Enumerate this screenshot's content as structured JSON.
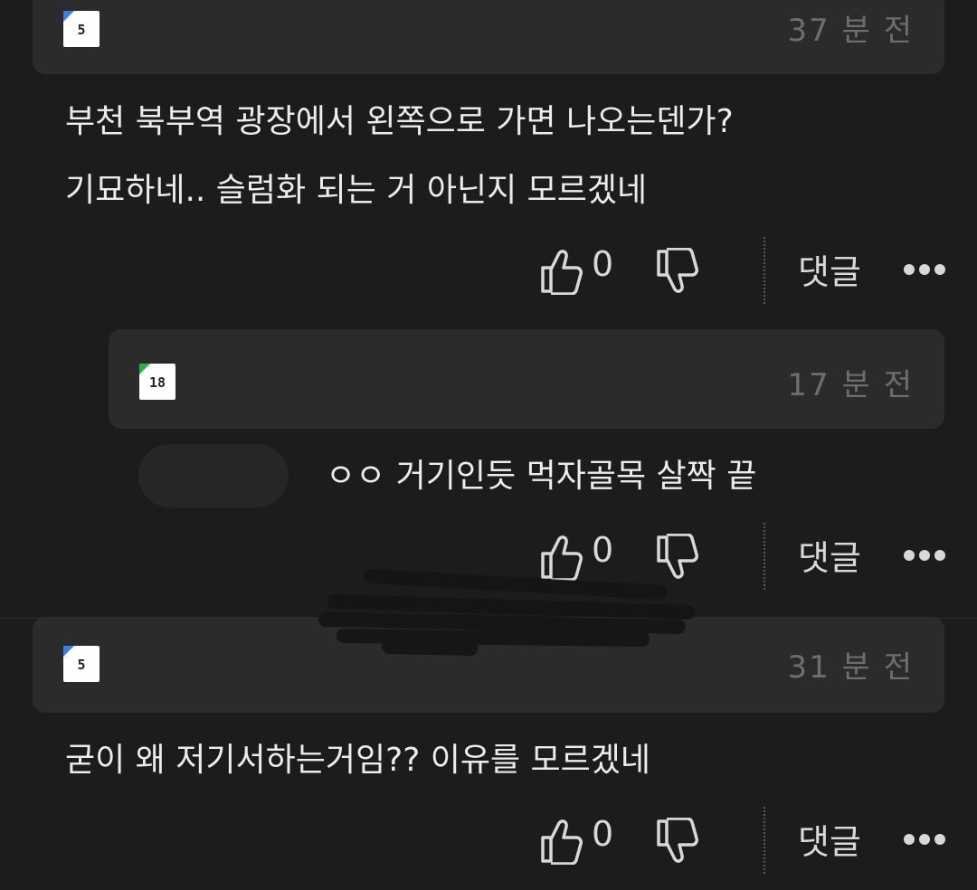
{
  "comments": [
    {
      "level_badge": "5",
      "time": "37 분 전",
      "text_lines": [
        "부천 북부역 광장에서 왼쪽으로 가면 나오는덴가?",
        "기묘하네.. 슬럼화 되는 거 아닌지 모르겠네"
      ],
      "likes": "0",
      "reply_label": "댓글"
    },
    {
      "level_badge": "18",
      "time": "17 분 전",
      "text": "ㅇㅇ 거기인듯 먹자골목 살짝 끝",
      "likes": "0",
      "reply_label": "댓글"
    },
    {
      "level_badge": "5",
      "time": "31 분 전",
      "text": "굳이 왜 저기서하는거임?? 이유를 모르겠네",
      "likes": "0",
      "reply_label": "댓글"
    }
  ],
  "colors": {
    "background": "#1c1c1c",
    "header": "#2b2b2b",
    "badge_blue": "#3a7fe0",
    "badge_green": "#2bb24c"
  },
  "icons": [
    "thumbs-up-icon",
    "thumbs-down-icon",
    "more-dots-icon"
  ]
}
